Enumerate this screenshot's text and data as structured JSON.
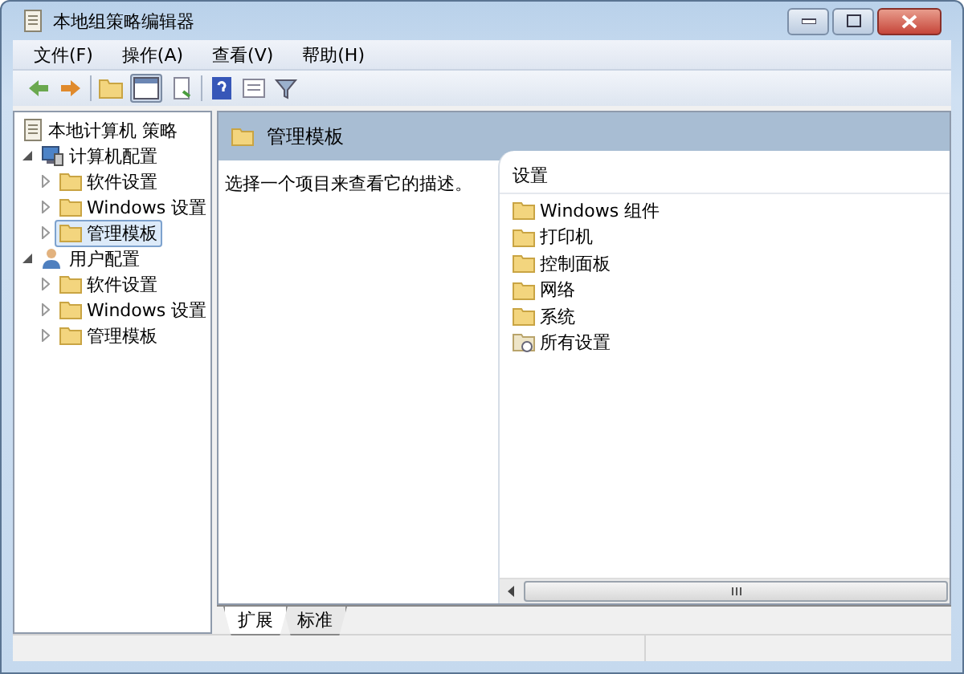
{
  "window": {
    "title": "本地组策略编辑器"
  },
  "menu": [
    "文件(F)",
    "操作(A)",
    "查看(V)",
    "帮助(H)"
  ],
  "tree": [
    {
      "label": "本地计算机 策略",
      "kind": "policy",
      "selected": false,
      "children": [
        {
          "label": "计算机配置",
          "kind": "computer",
          "expanded": true,
          "selected": false,
          "children": [
            {
              "label": "软件设置",
              "kind": "folder",
              "expanded": false,
              "selected": false
            },
            {
              "label": "Windows 设置",
              "kind": "folder",
              "expanded": false,
              "selected": false
            },
            {
              "label": "管理模板",
              "kind": "folder",
              "expanded": false,
              "selected": true
            }
          ]
        },
        {
          "label": "用户配置",
          "kind": "user",
          "expanded": true,
          "selected": false,
          "children": [
            {
              "label": "软件设置",
              "kind": "folder",
              "expanded": false,
              "selected": false
            },
            {
              "label": "Windows 设置",
              "kind": "folder",
              "expanded": false,
              "selected": false
            },
            {
              "label": "管理模板",
              "kind": "folder",
              "expanded": false,
              "selected": false
            }
          ]
        }
      ]
    }
  ],
  "details": {
    "heading": "管理模板",
    "description": "选择一个项目来查看它的描述。",
    "column": "设置",
    "items": [
      {
        "label": "Windows 组件",
        "kind": "folder"
      },
      {
        "label": "打印机",
        "kind": "folder"
      },
      {
        "label": "控制面板",
        "kind": "folder"
      },
      {
        "label": "网络",
        "kind": "folder"
      },
      {
        "label": "系统",
        "kind": "folder"
      },
      {
        "label": "所有设置",
        "kind": "all"
      }
    ]
  },
  "tabs": [
    {
      "label": "扩展",
      "selected": true
    },
    {
      "label": "标准",
      "selected": false
    }
  ]
}
